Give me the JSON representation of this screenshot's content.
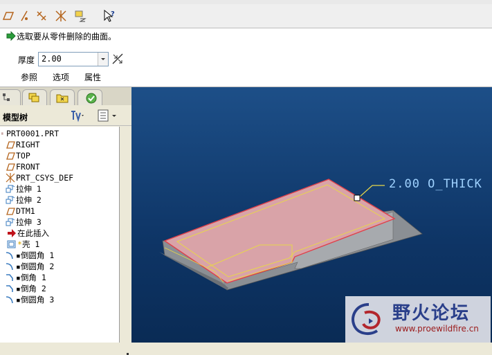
{
  "dashboard": {
    "prompt": "选取要从零件删除的曲面。",
    "thickness_label": "厚度",
    "thickness_value": "2.00",
    "tabs": [
      {
        "label": "参照"
      },
      {
        "label": "选项"
      },
      {
        "label": "属性"
      }
    ]
  },
  "tree": {
    "title": "模型树",
    "items": [
      {
        "label": "PRT0001.PRT",
        "icon": "part-icon"
      },
      {
        "label": "RIGHT",
        "icon": "datum-plane-icon"
      },
      {
        "label": "TOP",
        "icon": "datum-plane-icon"
      },
      {
        "label": "FRONT",
        "icon": "datum-plane-icon"
      },
      {
        "label": "PRT_CSYS_DEF",
        "icon": "csys-icon"
      },
      {
        "label": "拉伸 1",
        "icon": "extrude-icon"
      },
      {
        "label": "拉伸 2",
        "icon": "extrude-icon"
      },
      {
        "label": "DTM1",
        "icon": "datum-plane-icon"
      },
      {
        "label": "拉伸 3",
        "icon": "extrude-icon"
      },
      {
        "label": "在此插入",
        "icon": "insert-arrow-icon"
      },
      {
        "label": "壳 1",
        "icon": "shell-icon"
      },
      {
        "label": "倒圆角 1",
        "icon": "round-icon"
      },
      {
        "label": "倒圆角 2",
        "icon": "round-icon"
      },
      {
        "label": "倒角 1",
        "icon": "chamfer-icon"
      },
      {
        "label": "倒角 2",
        "icon": "chamfer-icon"
      },
      {
        "label": "倒圆角 3",
        "icon": "round-icon"
      }
    ]
  },
  "viewport": {
    "dimension_label": "2.00 O_THICK"
  },
  "watermark": {
    "title": "野火论坛",
    "url": "www.proewildfire.cn"
  },
  "colors": {
    "viewport_top": "#1d4f88",
    "viewport_bottom": "#0a2b55",
    "part_fill": "#d9a3a8",
    "highlight_edge": "#e0404a",
    "dimension": "#9fd2ff"
  }
}
